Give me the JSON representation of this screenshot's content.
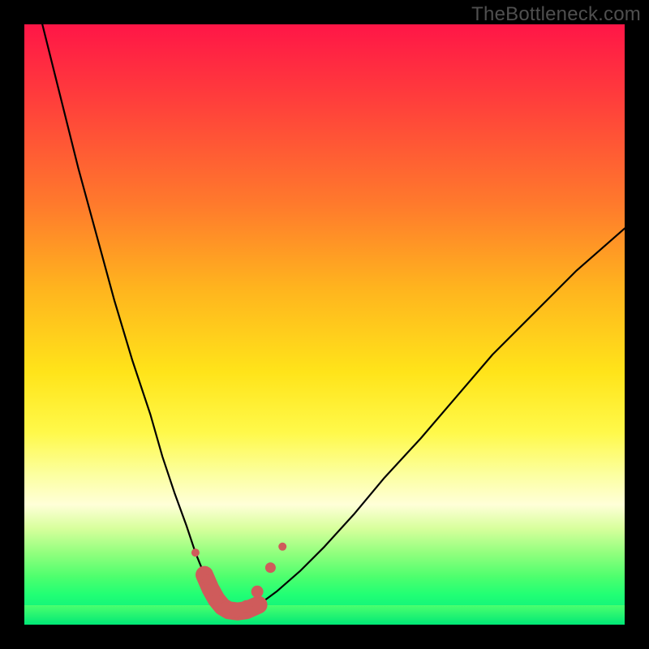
{
  "watermark": "TheBottleneck.com",
  "colors": {
    "frame_bg": "#000000",
    "curve_stroke": "#000000",
    "marker_fill": "#cf5b5b",
    "marker_stroke": "#cf5b5b",
    "gradient_top": "#ff1647",
    "gradient_bottom": "#00e876"
  },
  "chart_data": {
    "type": "line",
    "title": "",
    "xlabel": "",
    "ylabel": "",
    "xlim": [
      0,
      100
    ],
    "ylim": [
      0,
      100
    ],
    "grid": false,
    "legend": false,
    "series": [
      {
        "name": "bottleneck-curve",
        "x": [
          3,
          6,
          9,
          12,
          15,
          18,
          21,
          23,
          25,
          27,
          28.5,
          30,
          31,
          32,
          33,
          34,
          35.5,
          37,
          39,
          42,
          46,
          50,
          55,
          60,
          66,
          72,
          78,
          85,
          92,
          100
        ],
        "y": [
          100,
          88,
          76,
          65,
          54,
          44,
          35,
          28,
          22,
          16.5,
          12,
          8.3,
          6.0,
          4.2,
          3.0,
          2.4,
          2.2,
          2.4,
          3.3,
          5.5,
          9,
          13,
          18.5,
          24.5,
          31,
          38,
          45,
          52,
          59,
          66
        ],
        "notes": "Curve reaches minimum near x≈34.5. Values are read off the background gradient where 0=bottom(green) and 100=top(red)."
      }
    ],
    "markers": {
      "name": "highlighted-points",
      "description": "thick salmon/red markers clustered around curve minimum",
      "points": [
        {
          "x": 28.5,
          "y": 12.0,
          "size": 10
        },
        {
          "x": 30.5,
          "y": 7.5,
          "size": 13
        },
        {
          "x": 32.0,
          "y": 4.0,
          "size": 16
        },
        {
          "x": 33.5,
          "y": 2.6,
          "size": 18
        },
        {
          "x": 35.3,
          "y": 2.3,
          "size": 18
        },
        {
          "x": 37.0,
          "y": 3.0,
          "size": 16
        },
        {
          "x": 38.8,
          "y": 5.5,
          "size": 15
        },
        {
          "x": 41.0,
          "y": 9.5,
          "size": 13
        },
        {
          "x": 43.0,
          "y": 13.0,
          "size": 10
        }
      ]
    }
  }
}
